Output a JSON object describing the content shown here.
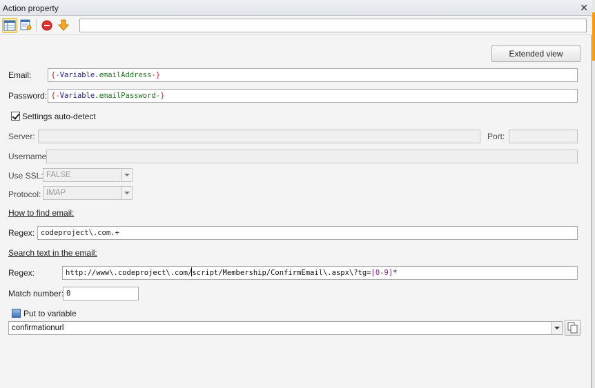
{
  "window": {
    "title": "Action property"
  },
  "toolbar": {
    "buttons": [
      {
        "name": "property-grid-icon",
        "active": true
      },
      {
        "name": "edit-script-icon",
        "active": false
      },
      {
        "name": "stop-icon",
        "active": false
      },
      {
        "name": "arrow-down-icon",
        "active": false
      }
    ],
    "search_value": ""
  },
  "extended_view_label": "Extended view",
  "email": {
    "label": "Email:",
    "value_parts": [
      "{-",
      "Variable",
      ".",
      "emailAddress",
      "-}"
    ]
  },
  "password": {
    "label": "Password:",
    "value_parts": [
      "{-",
      "Variable",
      ".",
      "emailPassword",
      "-}"
    ]
  },
  "settings_autodetect": {
    "label": "Settings auto-detect",
    "checked": true
  },
  "server": {
    "label": "Server:",
    "value": ""
  },
  "port": {
    "label": "Port:",
    "value": ""
  },
  "username": {
    "label": "Username",
    "value": ""
  },
  "use_ssl": {
    "label": "Use SSL:",
    "value": "FALSE"
  },
  "protocol": {
    "label": "Protocol:",
    "value": "IMAP"
  },
  "how_to_find": {
    "heading": "How to find email:",
    "regex_label": "Regex:",
    "regex_value": "codeproject\\.com.+"
  },
  "search_text": {
    "heading": "Search text in the email:",
    "regex_label": "Regex:",
    "regex_parts": [
      "http://www\\.codeproject\\.com/",
      "script/Membership/ConfirmEmail\\.aspx\\?tg=",
      "[0-9]",
      "*"
    ],
    "match_label": "Match number:",
    "match_value": "0"
  },
  "put_to_variable": {
    "label": "Put to variable",
    "value": "confirmationurl"
  },
  "colors": {
    "accent_orange": "#f39c12",
    "token_brace": "#c0243b",
    "token_variable": "#1a1a8c",
    "token_property": "#207020"
  }
}
